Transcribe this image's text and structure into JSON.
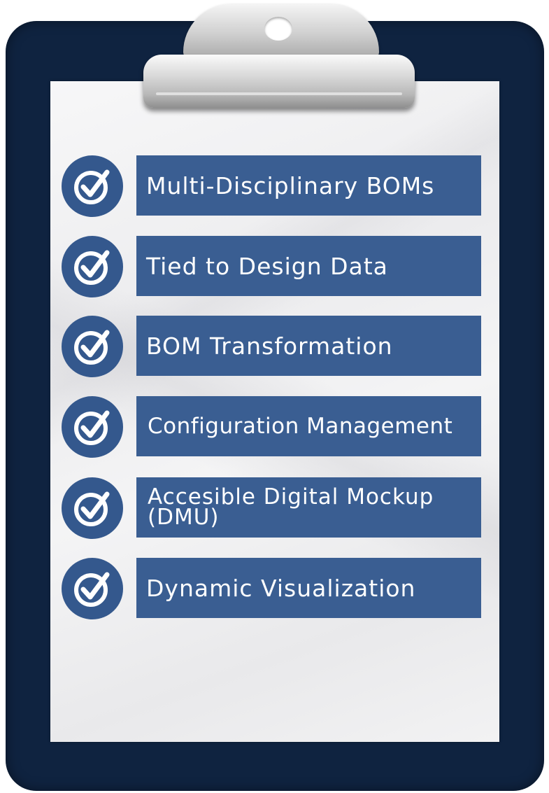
{
  "colors": {
    "board": "#0f2340",
    "item_bar": "#3a5e92",
    "check_circle": "#34588d",
    "text": "#ffffff"
  },
  "checklist": {
    "items": [
      {
        "label": "Multi-Disciplinary BOMs",
        "icon": "check-circle-icon"
      },
      {
        "label": "Tied to Design Data",
        "icon": "check-circle-icon"
      },
      {
        "label": "BOM Transformation",
        "icon": "check-circle-icon"
      },
      {
        "label": "Configuration Management",
        "icon": "check-circle-icon"
      },
      {
        "label": "Accesible Digital Mockup (DMU)",
        "icon": "check-circle-icon"
      },
      {
        "label": "Dynamic Visualization",
        "icon": "check-circle-icon"
      }
    ]
  }
}
